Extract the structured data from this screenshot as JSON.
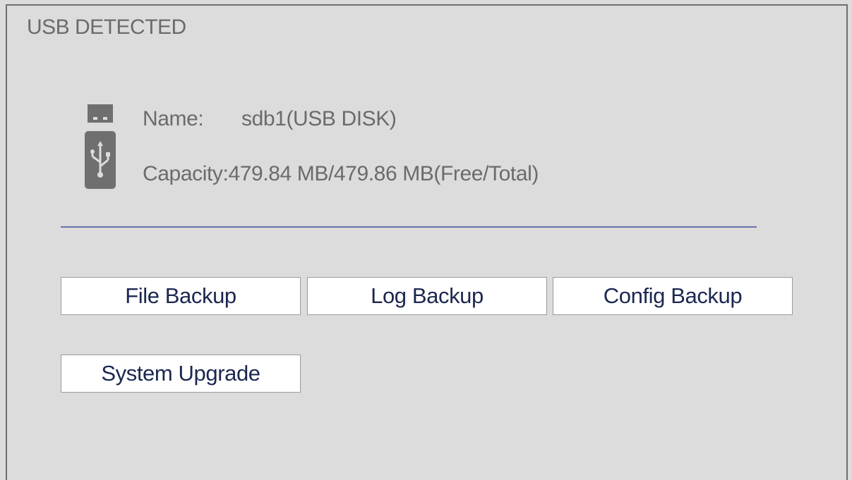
{
  "dialog": {
    "title": "USB DETECTED"
  },
  "device": {
    "icon": "usb-drive-icon",
    "name_label": "Name:",
    "name_value": "sdb1(USB DISK)",
    "capacity_label": "Capacity:",
    "capacity_value": "479.84 MB/479.86 MB(Free/Total)"
  },
  "buttons": {
    "file_backup": "File Backup",
    "log_backup": "Log Backup",
    "config_backup": "Config Backup",
    "system_upgrade": "System Upgrade"
  },
  "colors": {
    "background": "#dcdcdc",
    "border": "#6f6f6f",
    "text": "#6b6b6b",
    "divider": "#6872a8",
    "button_text": "#1c2750",
    "button_bg": "#ffffff"
  }
}
